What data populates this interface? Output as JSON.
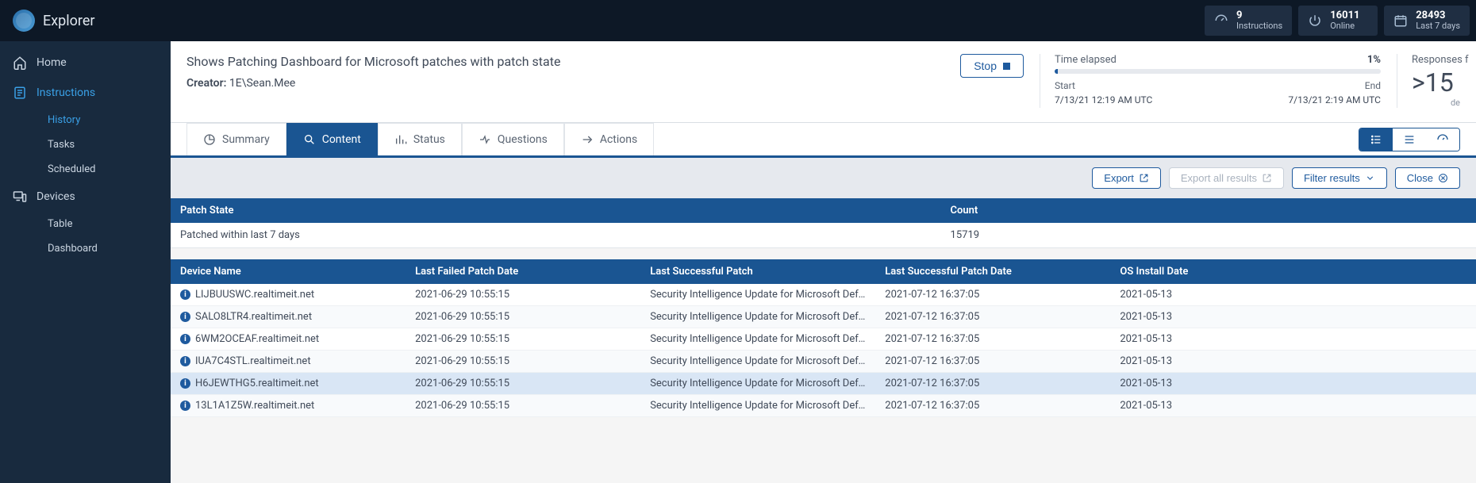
{
  "brand": "Explorer",
  "status_boxes": {
    "instructions": {
      "value": "9",
      "label": "Instructions"
    },
    "online": {
      "value": "16011",
      "label": "Online"
    },
    "period": {
      "value": "28493",
      "label": "Last 7 days"
    }
  },
  "sidebar": {
    "home": "Home",
    "instructions": "Instructions",
    "instructions_sub": {
      "history": "History",
      "tasks": "Tasks",
      "scheduled": "Scheduled"
    },
    "devices": "Devices",
    "devices_sub": {
      "table": "Table",
      "dashboard": "Dashboard"
    }
  },
  "header": {
    "title": "Shows Patching Dashboard for Microsoft patches with patch state",
    "creator_label": "Creator:",
    "creator_value": "1E\\Sean.Mee",
    "stop": "Stop"
  },
  "timeline": {
    "elapsed_label": "Time elapsed",
    "percent": "1%",
    "percent_val": 1,
    "start_label": "Start",
    "start_value": "7/13/21 12:19 AM UTC",
    "end_label": "End",
    "end_value": "7/13/21 2:19 AM UTC"
  },
  "responses": {
    "label": "Responses f",
    "value": ">15",
    "sub": "de"
  },
  "tabs": {
    "summary": "Summary",
    "content": "Content",
    "status": "Status",
    "questions": "Questions",
    "actions": "Actions"
  },
  "toolbar": {
    "export": "Export",
    "export_all": "Export all results",
    "filter": "Filter results",
    "close": "Close"
  },
  "summary_table": {
    "headers": {
      "state": "Patch State",
      "count": "Count"
    },
    "rows": [
      {
        "state": "Patched within last 7 days",
        "count": "15719"
      }
    ]
  },
  "detail_table": {
    "headers": {
      "device": "Device Name",
      "last_failed": "Last Failed Patch Date",
      "last_success": "Last Successful Patch",
      "last_success_date": "Last Successful Patch Date",
      "os_install": "OS Install Date"
    },
    "rows": [
      {
        "device": "LIJBUUSWC.realtimeit.net",
        "last_failed": "2021-06-29 10:55:15",
        "last_success": "Security Intelligence Update for Microsoft Defender A...",
        "last_success_date": "2021-07-12 16:37:05",
        "os_install": "2021-05-13"
      },
      {
        "device": "SALO8LTR4.realtimeit.net",
        "last_failed": "2021-06-29 10:55:15",
        "last_success": "Security Intelligence Update for Microsoft Defender A...",
        "last_success_date": "2021-07-12 16:37:05",
        "os_install": "2021-05-13"
      },
      {
        "device": "6WM2OCEAF.realtimeit.net",
        "last_failed": "2021-06-29 10:55:15",
        "last_success": "Security Intelligence Update for Microsoft Defender A...",
        "last_success_date": "2021-07-12 16:37:05",
        "os_install": "2021-05-13"
      },
      {
        "device": "IUA7C4STL.realtimeit.net",
        "last_failed": "2021-06-29 10:55:15",
        "last_success": "Security Intelligence Update for Microsoft Defender A...",
        "last_success_date": "2021-07-12 16:37:05",
        "os_install": "2021-05-13"
      },
      {
        "device": "H6JEWTHG5.realtimeit.net",
        "last_failed": "2021-06-29 10:55:15",
        "last_success": "Security Intelligence Update for Microsoft Defender A...",
        "last_success_date": "2021-07-12 16:37:05",
        "os_install": "2021-05-13",
        "hover": true
      },
      {
        "device": "13L1A1Z5W.realtimeit.net",
        "last_failed": "2021-06-29 10:55:15",
        "last_success": "Security Intelligence Update for Microsoft Defender A...",
        "last_success_date": "2021-07-12 16:37:05",
        "os_install": "2021-05-13"
      }
    ]
  }
}
